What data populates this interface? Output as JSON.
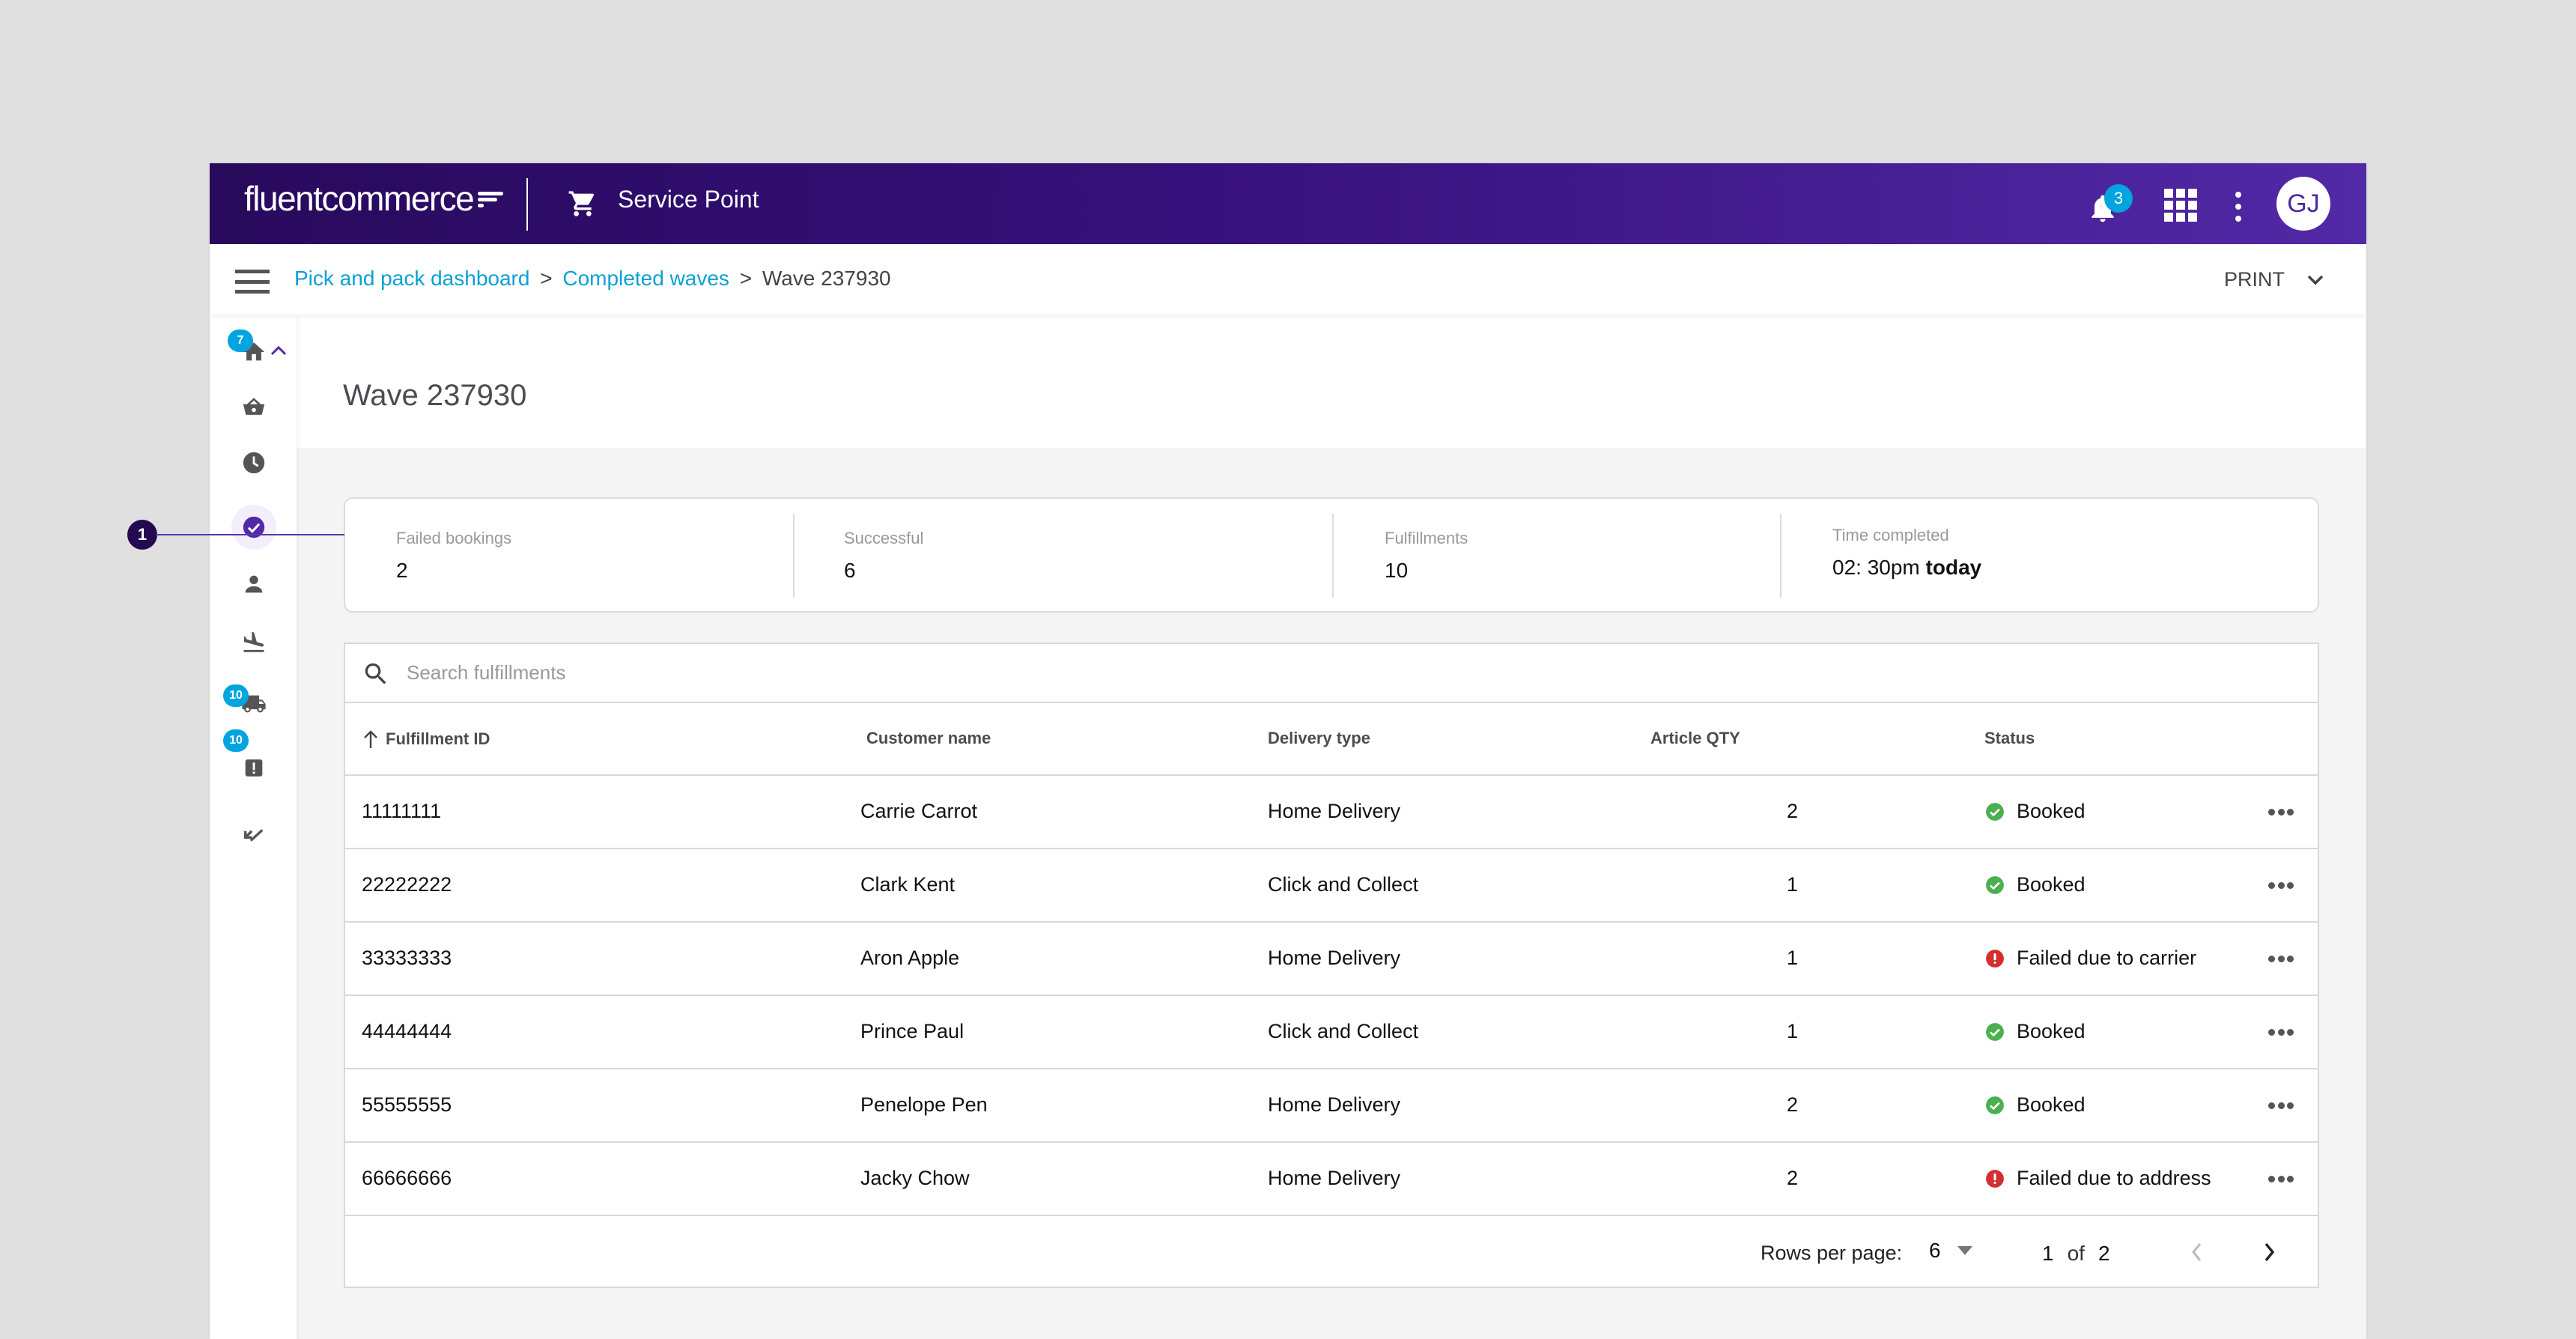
{
  "app": {
    "logo_text_bold": "fluent",
    "logo_text": "commerce",
    "name": "Service Point",
    "notification_count": "3",
    "user_initials": "GJ"
  },
  "breadcrumb": {
    "items": [
      "Pick and pack dashboard",
      "Completed waves",
      "Wave 237930"
    ],
    "separator": ">"
  },
  "toolbar": {
    "print_label": "PRINT"
  },
  "sidebar": {
    "items": [
      {
        "icon": "home-icon",
        "badge": "7",
        "expanded": true
      },
      {
        "icon": "basket-icon",
        "badge": null
      },
      {
        "icon": "clock-icon",
        "badge": null
      },
      {
        "icon": "check-circle-icon",
        "badge": null,
        "active": true
      },
      {
        "icon": "person-icon",
        "badge": null
      },
      {
        "icon": "flight-land-icon",
        "badge": null
      },
      {
        "icon": "truck-icon",
        "badge": "10"
      },
      {
        "icon": "warning-box-icon",
        "badge": "10"
      },
      {
        "icon": "call-received-icon",
        "badge": null
      }
    ]
  },
  "page": {
    "title": "Wave 237930"
  },
  "summary": [
    {
      "label": "Failed bookings",
      "value": "2"
    },
    {
      "label": "Successful",
      "value": "6"
    },
    {
      "label": "Fulfillments",
      "value": "10"
    },
    {
      "label": "Time completed",
      "value": "02: 30pm",
      "value_suffix": "today"
    }
  ],
  "search": {
    "placeholder": "Search fulfillments",
    "value": ""
  },
  "table": {
    "columns": [
      "Fulfillment ID",
      "Customer name",
      "Delivery type",
      "Article QTY",
      "Status"
    ],
    "sort": {
      "column": "Fulfillment ID",
      "direction": "ascending"
    },
    "rows": [
      {
        "id": "11111111",
        "customer": "Carrie Carrot",
        "delivery": "Home Delivery",
        "qty": "2",
        "status": "Booked",
        "status_type": "success"
      },
      {
        "id": "22222222",
        "customer": "Clark Kent",
        "delivery": "Click and Collect",
        "qty": "1",
        "status": "Booked",
        "status_type": "success"
      },
      {
        "id": "33333333",
        "customer": "Aron Apple",
        "delivery": "Home Delivery",
        "qty": "1",
        "status": "Failed due to carrier",
        "status_type": "error"
      },
      {
        "id": "44444444",
        "customer": "Prince Paul",
        "delivery": "Click and Collect",
        "qty": "1",
        "status": "Booked",
        "status_type": "success"
      },
      {
        "id": "55555555",
        "customer": "Penelope Pen",
        "delivery": "Home Delivery",
        "qty": "2",
        "status": "Booked",
        "status_type": "success"
      },
      {
        "id": "66666666",
        "customer": "Jacky Chow",
        "delivery": "Home Delivery",
        "qty": "2",
        "status": "Failed due to address",
        "status_type": "error"
      }
    ]
  },
  "pagination": {
    "rows_per_page_label": "Rows per page:",
    "rows_per_page": "6",
    "current_page": "1",
    "of_label": "of",
    "total_pages": "2"
  },
  "annotation": {
    "marker": "1"
  },
  "colors": {
    "brand_dark": "#280a5c",
    "brand": "#5229a6",
    "link": "#0aa0d6",
    "badge": "#00a5e0",
    "success": "#4caf50",
    "error": "#d32f2f"
  }
}
